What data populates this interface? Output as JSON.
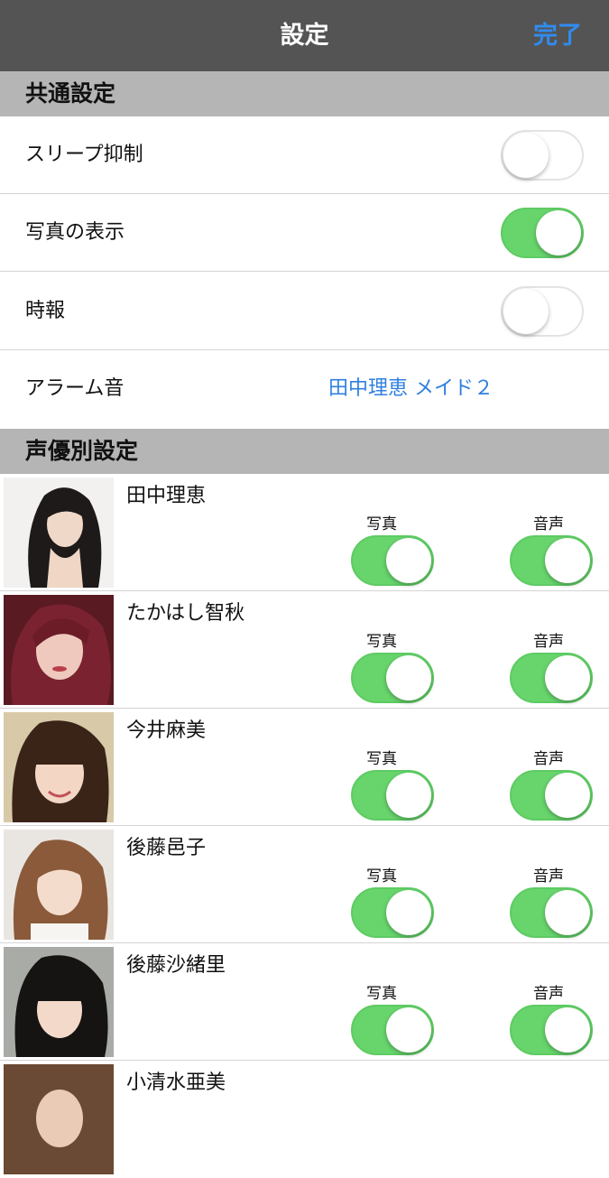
{
  "navbar": {
    "title": "設定",
    "done_label": "完了"
  },
  "common_section": {
    "header": "共通設定",
    "rows": [
      {
        "label": "スリープ抑制",
        "toggle_on": false
      },
      {
        "label": "写真の表示",
        "toggle_on": true
      },
      {
        "label": "時報",
        "toggle_on": false
      }
    ],
    "alarm": {
      "label": "アラーム音",
      "value": "田中理恵 メイド２"
    }
  },
  "actor_section": {
    "header": "声優別設定",
    "photo_label": "写真",
    "voice_label": "音声",
    "actors": [
      {
        "name": "田中理恵",
        "photo_on": true,
        "voice_on": true
      },
      {
        "name": "たかはし智秋",
        "photo_on": true,
        "voice_on": true
      },
      {
        "name": "今井麻美",
        "photo_on": true,
        "voice_on": true
      },
      {
        "name": "後藤邑子",
        "photo_on": true,
        "voice_on": true
      },
      {
        "name": "後藤沙緒里",
        "photo_on": true,
        "voice_on": true
      },
      {
        "name": "小清水亜美"
      }
    ]
  }
}
